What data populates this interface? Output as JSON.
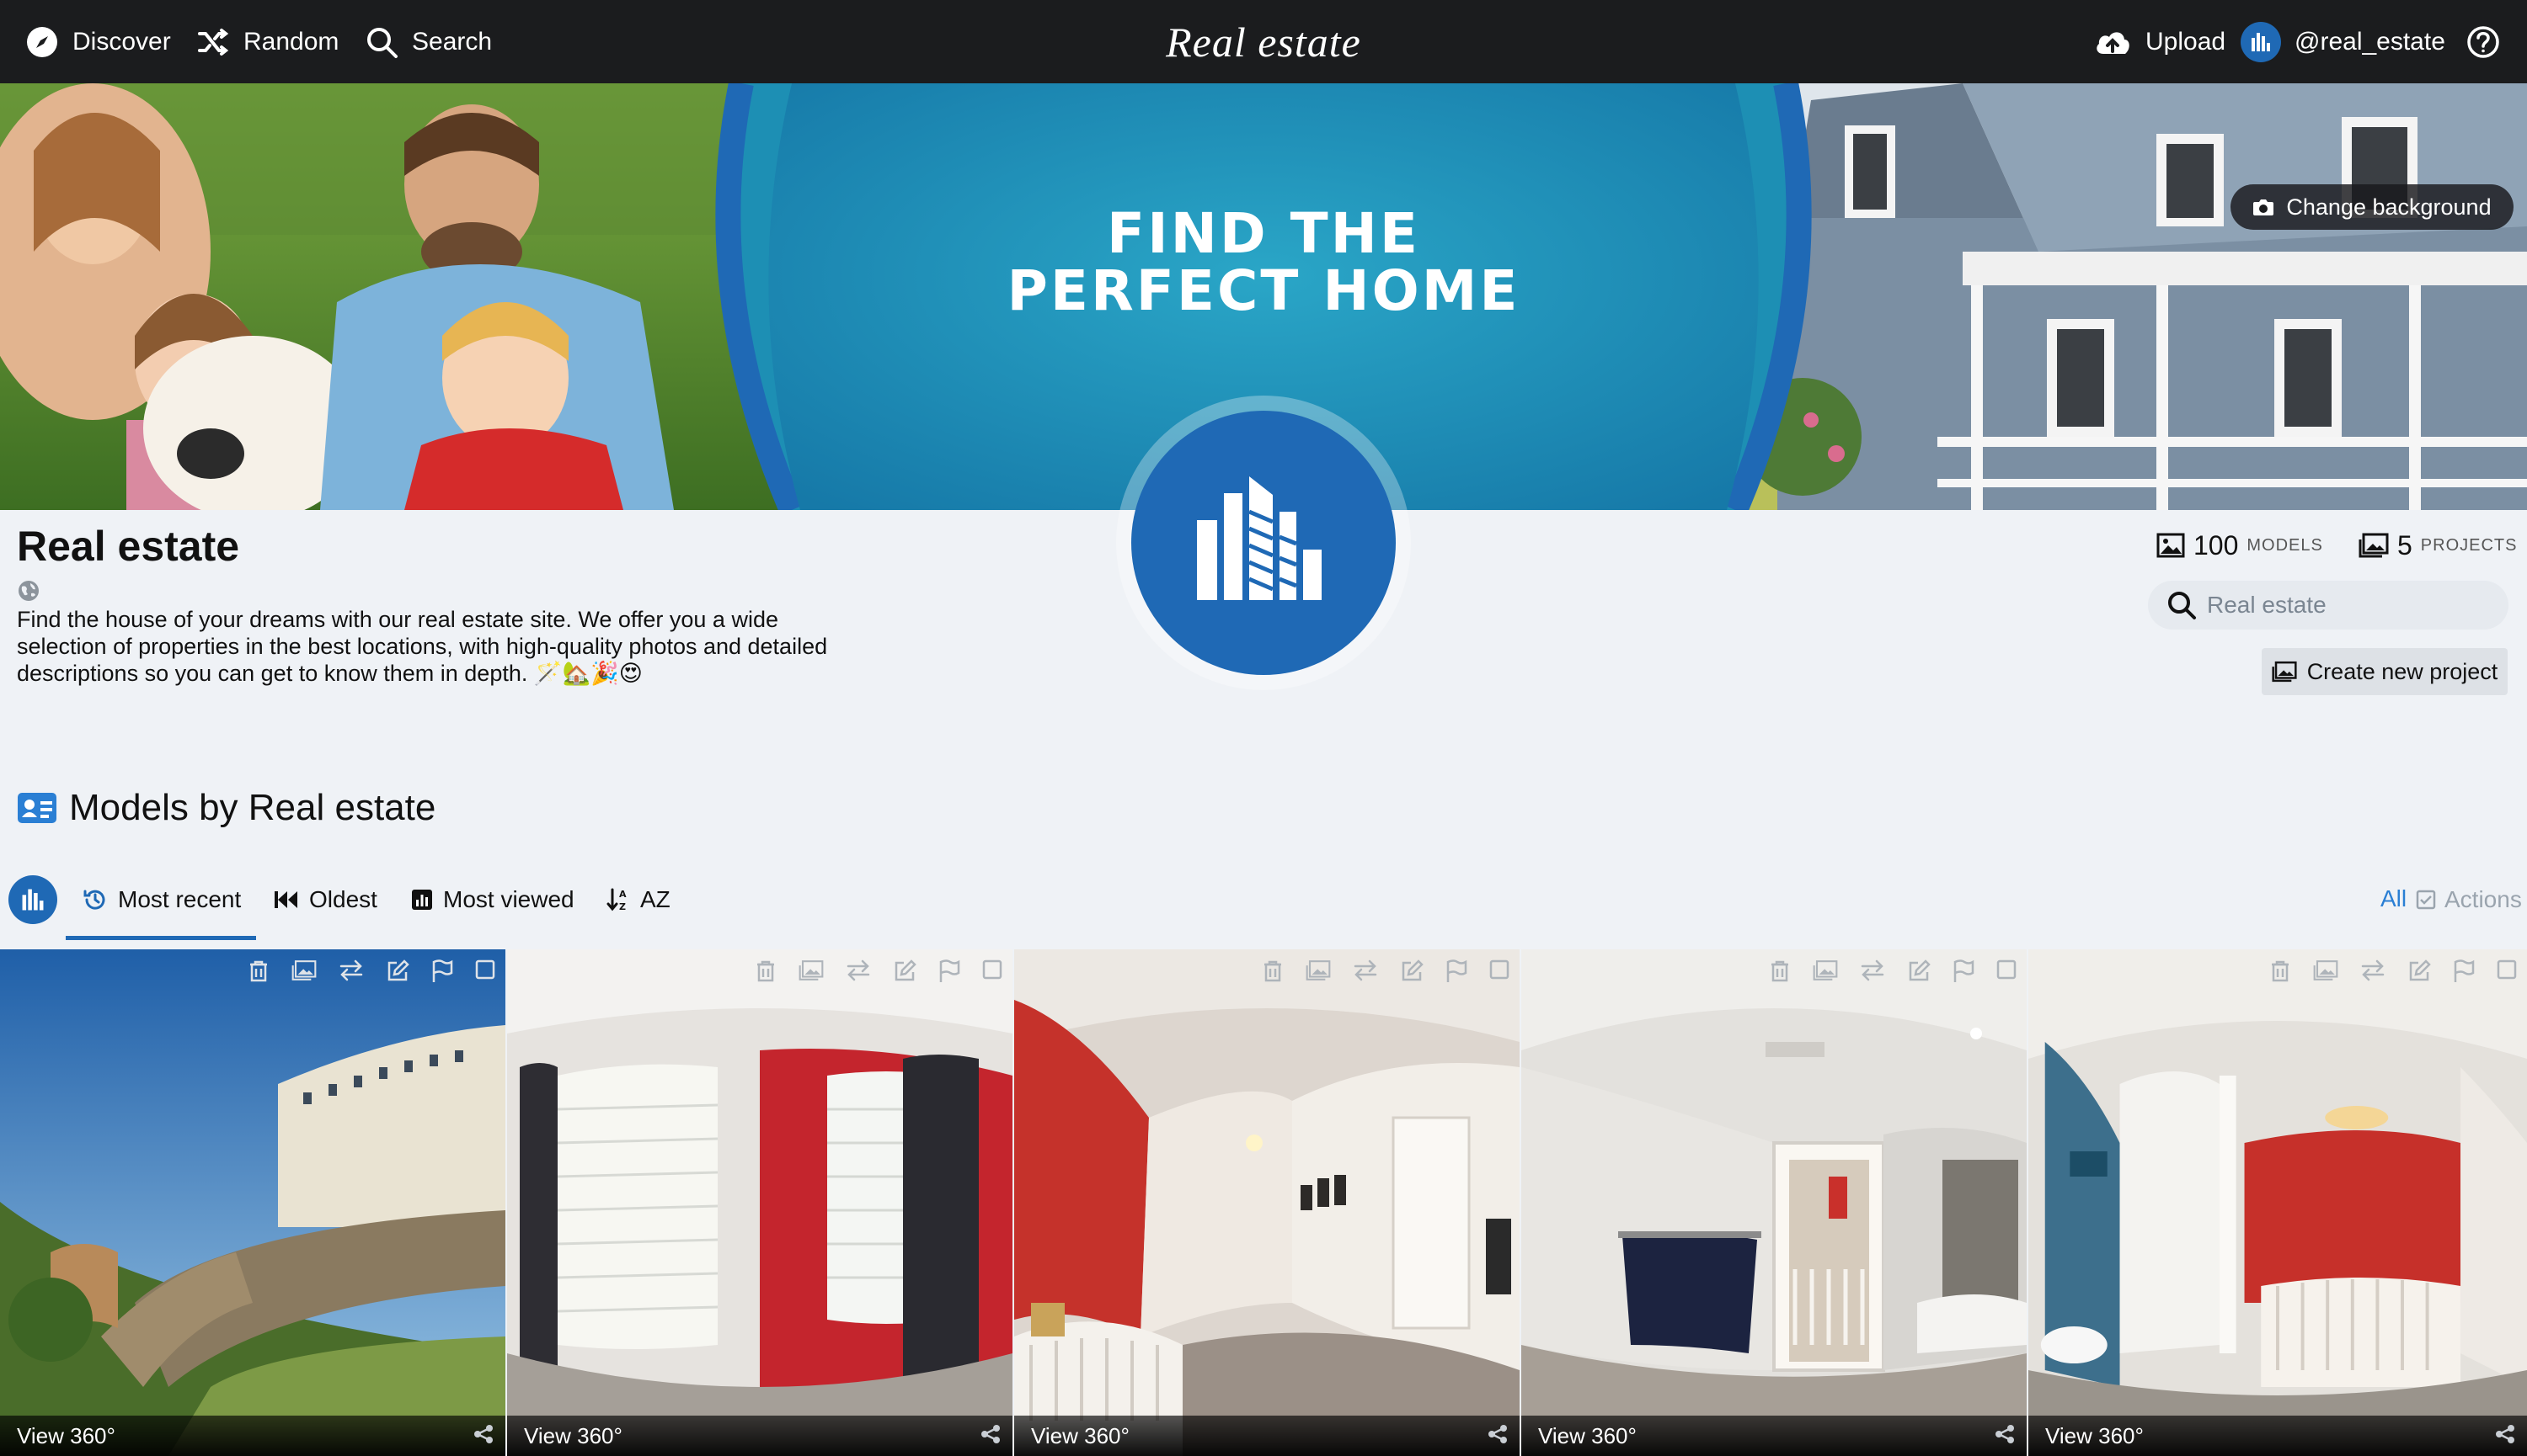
{
  "nav": {
    "discover": "Discover",
    "random": "Random",
    "search": "Search",
    "brand": "Real estate",
    "upload": "Upload",
    "username": "@real_estate"
  },
  "hero": {
    "title_line1": "FIND THE",
    "title_line2": "PERFECT HOME",
    "change_background": "Change background"
  },
  "profile": {
    "name": "Real estate",
    "description": "Find the house of your dreams with our real estate site. We offer you a wide selection of properties in the best locations, with high-quality photos and detailed descriptions so you can get to know them in depth. 🪄🏡🎉😍"
  },
  "stats": {
    "models_count": "100",
    "models_label": "MODELS",
    "projects_count": "5",
    "projects_label": "PROJECTS"
  },
  "search": {
    "placeholder": "Real estate"
  },
  "create_project": "Create new project",
  "section": {
    "title": "Models by Real estate"
  },
  "sort": {
    "tabs": [
      {
        "label": "Most recent",
        "active": true
      },
      {
        "label": "Oldest"
      },
      {
        "label": "Most viewed"
      },
      {
        "label": "AZ"
      }
    ],
    "all": "All",
    "actions": "Actions"
  },
  "models": [
    {
      "label": "View 360°"
    },
    {
      "label": "View 360°"
    },
    {
      "label": "View 360°"
    },
    {
      "label": "View 360°"
    },
    {
      "label": "View 360°"
    }
  ],
  "colors": {
    "brand_blue": "#1f69b5",
    "topbar": "#1b1c1e",
    "link_blue": "#2a7fd4"
  }
}
